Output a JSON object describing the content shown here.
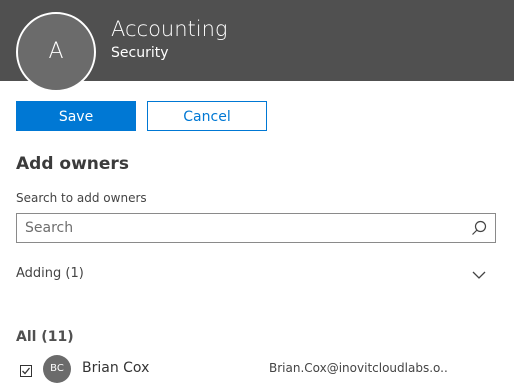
{
  "header": {
    "avatar_initial": "A",
    "group_name": "Accounting",
    "group_type": "Security",
    "background_color": "#505050"
  },
  "actions": {
    "save_label": "Save",
    "cancel_label": "Cancel",
    "accent_color": "#0078d4"
  },
  "owners": {
    "section_title": "Add owners",
    "search_label": "Search to add owners",
    "search_placeholder": "Search",
    "search_value": "",
    "search_icon": "search-icon",
    "adding_label": "Adding (1)",
    "expand_icon": "chevron-down-icon"
  },
  "members": {
    "all_label": "All (11)",
    "rows": [
      {
        "checked": true,
        "initials": "BC",
        "name": "Brian Cox",
        "email": "Brian.Cox@inovitcloudlabs.o..."
      }
    ]
  }
}
